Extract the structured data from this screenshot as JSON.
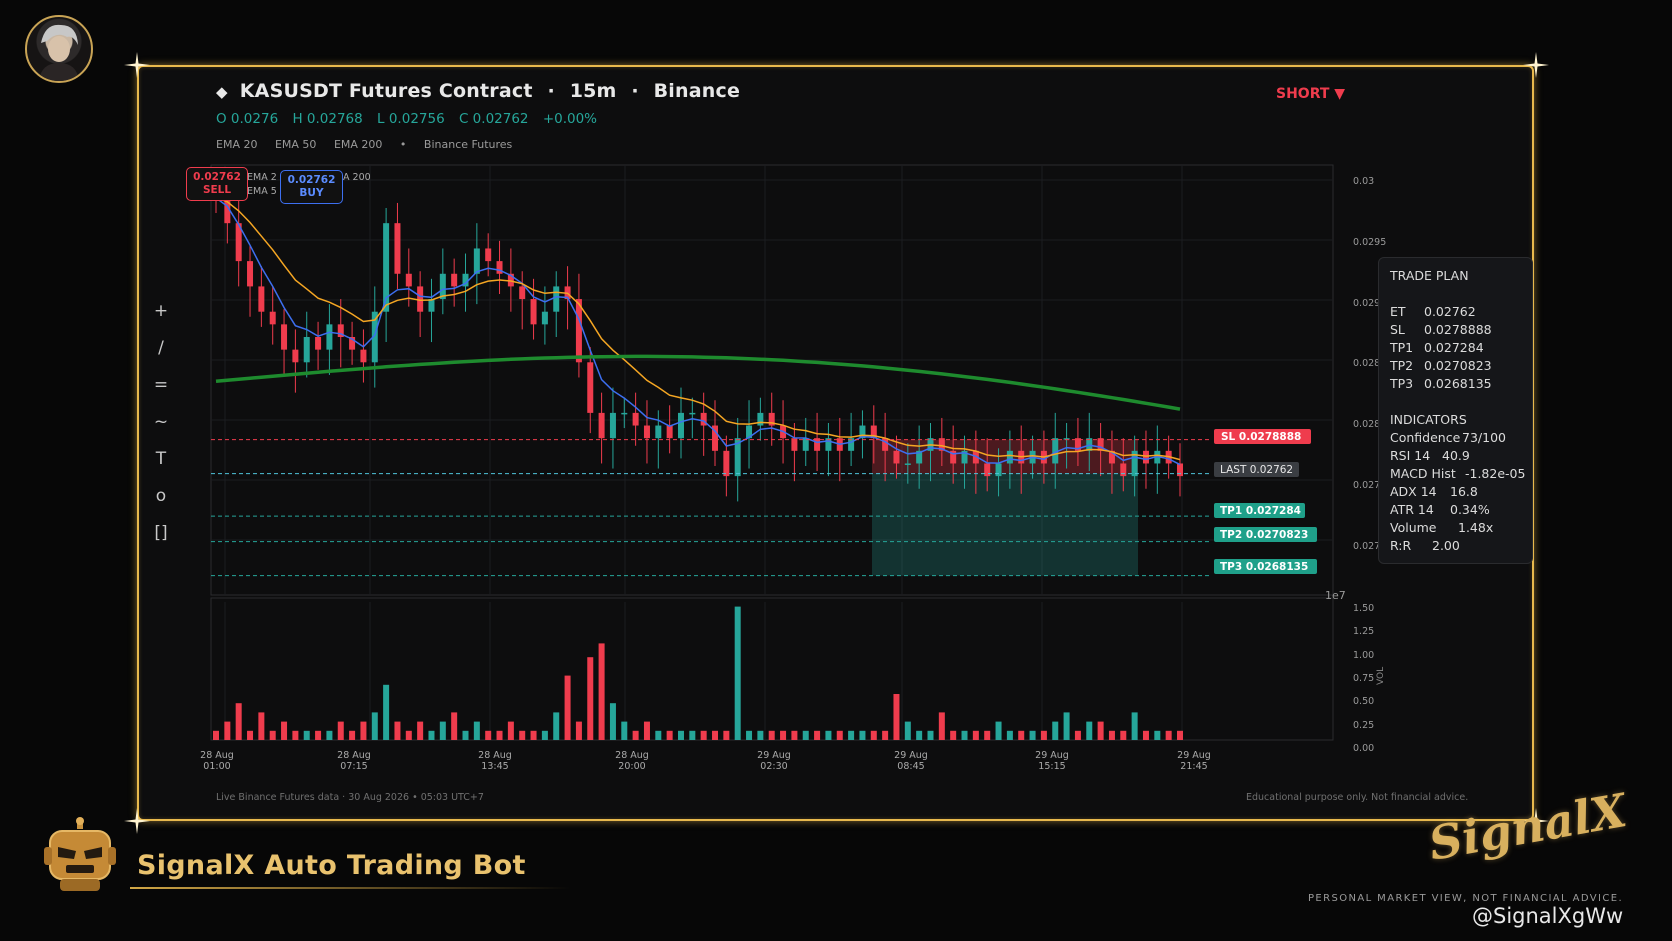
{
  "header": {
    "symbol": "KASUSDT Futures Contract",
    "sep1": "·",
    "timeframe": "15m",
    "sep2": "·",
    "exchange": "Binance",
    "ohlc": {
      "o": "O 0.0276",
      "h": "H 0.02768",
      "l": "L 0.02756",
      "c": "C 0.02762",
      "chg": "+0.00%"
    },
    "indicators": [
      "EMA 20",
      "EMA 50",
      "EMA 200",
      "•",
      "Binance Futures"
    ],
    "direction": "SHORT ▼"
  },
  "toolbar": [
    "+",
    "/",
    "=",
    "~",
    "T",
    "o",
    "[]"
  ],
  "pills": {
    "sell_price": "0.02762",
    "sell_label": "SELL",
    "buy_price": "0.02762",
    "buy_label": "BUY"
  },
  "legend_fragments": [
    "EMA 2",
    "EMA 5",
    "A 200"
  ],
  "price_axis": {
    "ticks": [
      "0.03",
      "0.0295",
      "0.029",
      "0.028",
      "0.028",
      "0.027",
      "0.027"
    ],
    "multiplier": "1e7"
  },
  "volume_axis": {
    "ticks": [
      "1.50",
      "1.25",
      "1.00",
      "0.75",
      "0.50",
      "0.25",
      "0.00"
    ],
    "label": "VOL"
  },
  "time_axis": [
    {
      "d": "28 Aug",
      "t": "01:00"
    },
    {
      "d": "28 Aug",
      "t": "07:15"
    },
    {
      "d": "28 Aug",
      "t": "13:45"
    },
    {
      "d": "28 Aug",
      "t": "20:00"
    },
    {
      "d": "29 Aug",
      "t": "02:30"
    },
    {
      "d": "29 Aug",
      "t": "08:45"
    },
    {
      "d": "29 Aug",
      "t": "15:15"
    },
    {
      "d": "29 Aug",
      "t": "21:45"
    }
  ],
  "levels": {
    "sl": "SL  0.0278888",
    "last": "LAST  0.02762",
    "tp1": "TP1  0.027284",
    "tp2": "TP2  0.0270823",
    "tp3": "TP3  0.0268135"
  },
  "trade_plan": {
    "title": "TRADE PLAN",
    "rows": [
      {
        "k": "ET",
        "v": "0.02762"
      },
      {
        "k": "SL",
        "v": "0.0278888"
      },
      {
        "k": "TP1",
        "v": "0.027284"
      },
      {
        "k": "TP2",
        "v": "0.0270823"
      },
      {
        "k": "TP3",
        "v": "0.0268135"
      }
    ],
    "ind_title": "INDICATORS",
    "ind_rows": [
      {
        "k": "Confidence",
        "v": "73/100"
      },
      {
        "k": "RSI 14",
        "v": "40.9"
      },
      {
        "k": "MACD Hist",
        "v": "-1.82e-05"
      },
      {
        "k": "ADX 14",
        "v": "16.8"
      },
      {
        "k": "ATR 14",
        "v": "0.34%"
      },
      {
        "k": "Volume",
        "v": "1.48x"
      },
      {
        "k": "R:R",
        "v": "2.00"
      }
    ]
  },
  "footer": {
    "left": "Live Binance Futures data  ·  30 Aug 2026 • 05:03 UTC+7",
    "right": "Educational purpose only. Not financial advice."
  },
  "branding": {
    "bot_name": "SignalX Auto Trading Bot",
    "brand": "SignalX",
    "disclaimer": "PERSONAL MARKET VIEW, NOT FINANCIAL ADVICE.",
    "watermark": "@SignalXgWw"
  },
  "colors": {
    "accent_gold": "#e8b94d",
    "bull": "#26a69a",
    "bear": "#ef3c4d",
    "ema20": "#3d6ff0",
    "ema50": "#f5a623",
    "ema200": "#1e8b2e"
  },
  "chart_data": {
    "type": "candlestick",
    "x_axis": "time",
    "ema_lines": [
      "EMA 20",
      "EMA 50",
      "EMA 200"
    ],
    "trade_levels": {
      "sl": 0.0278888,
      "last": 0.02762,
      "tp1": 0.027284,
      "tp2": 0.0270823,
      "tp3": 0.0268135
    },
    "price_series_close": [
      0.0298,
      0.0296,
      0.0293,
      0.0291,
      0.0289,
      0.0288,
      0.0286,
      0.0285,
      0.0287,
      0.0286,
      0.0288,
      0.0287,
      0.0286,
      0.0285,
      0.0289,
      0.0296,
      0.0292,
      0.0291,
      0.0289,
      0.029,
      0.0292,
      0.0291,
      0.0292,
      0.0294,
      0.0293,
      0.0292,
      0.0291,
      0.029,
      0.0288,
      0.0289,
      0.0291,
      0.029,
      0.0285,
      0.0281,
      0.0279,
      0.0281,
      0.0281,
      0.028,
      0.0279,
      0.028,
      0.0279,
      0.0281,
      0.0281,
      0.028,
      0.0278,
      0.0276,
      0.0279,
      0.028,
      0.0281,
      0.028,
      0.0279,
      0.0278,
      0.0279,
      0.0278,
      0.0279,
      0.0278,
      0.0279,
      0.028,
      0.0279,
      0.0278,
      0.0277,
      0.0277,
      0.0278,
      0.0279,
      0.0278,
      0.0277,
      0.0278,
      0.0277,
      0.0276,
      0.0277,
      0.0278,
      0.0277,
      0.0278,
      0.0277,
      0.0279,
      0.0279,
      0.0278,
      0.0279,
      0.0278,
      0.0277,
      0.0276,
      0.0278,
      0.0277,
      0.0278,
      0.0277,
      0.0276
    ],
    "volume_series": [
      0.1,
      0.2,
      0.4,
      0.1,
      0.3,
      0.1,
      0.2,
      0.1,
      0.1,
      0.1,
      0.1,
      0.2,
      0.1,
      0.2,
      0.3,
      0.6,
      0.2,
      0.1,
      0.2,
      0.1,
      0.2,
      0.3,
      0.1,
      0.2,
      0.1,
      0.1,
      0.2,
      0.1,
      0.1,
      0.1,
      0.3,
      0.7,
      0.2,
      0.9,
      1.05,
      0.4,
      0.2,
      0.1,
      0.2,
      0.1,
      0.1,
      0.1,
      0.1,
      0.1,
      0.1,
      0.1,
      1.45,
      0.1,
      0.1,
      0.1,
      0.1,
      0.1,
      0.1,
      0.1,
      0.1,
      0.1,
      0.1,
      0.1,
      0.1,
      0.1,
      0.5,
      0.2,
      0.1,
      0.1,
      0.3,
      0.1,
      0.1,
      0.1,
      0.1,
      0.2,
      0.1,
      0.1,
      0.1,
      0.1,
      0.2,
      0.3,
      0.1,
      0.2,
      0.2,
      0.1,
      0.1,
      0.3,
      0.1,
      0.1,
      0.1,
      0.1
    ]
  }
}
